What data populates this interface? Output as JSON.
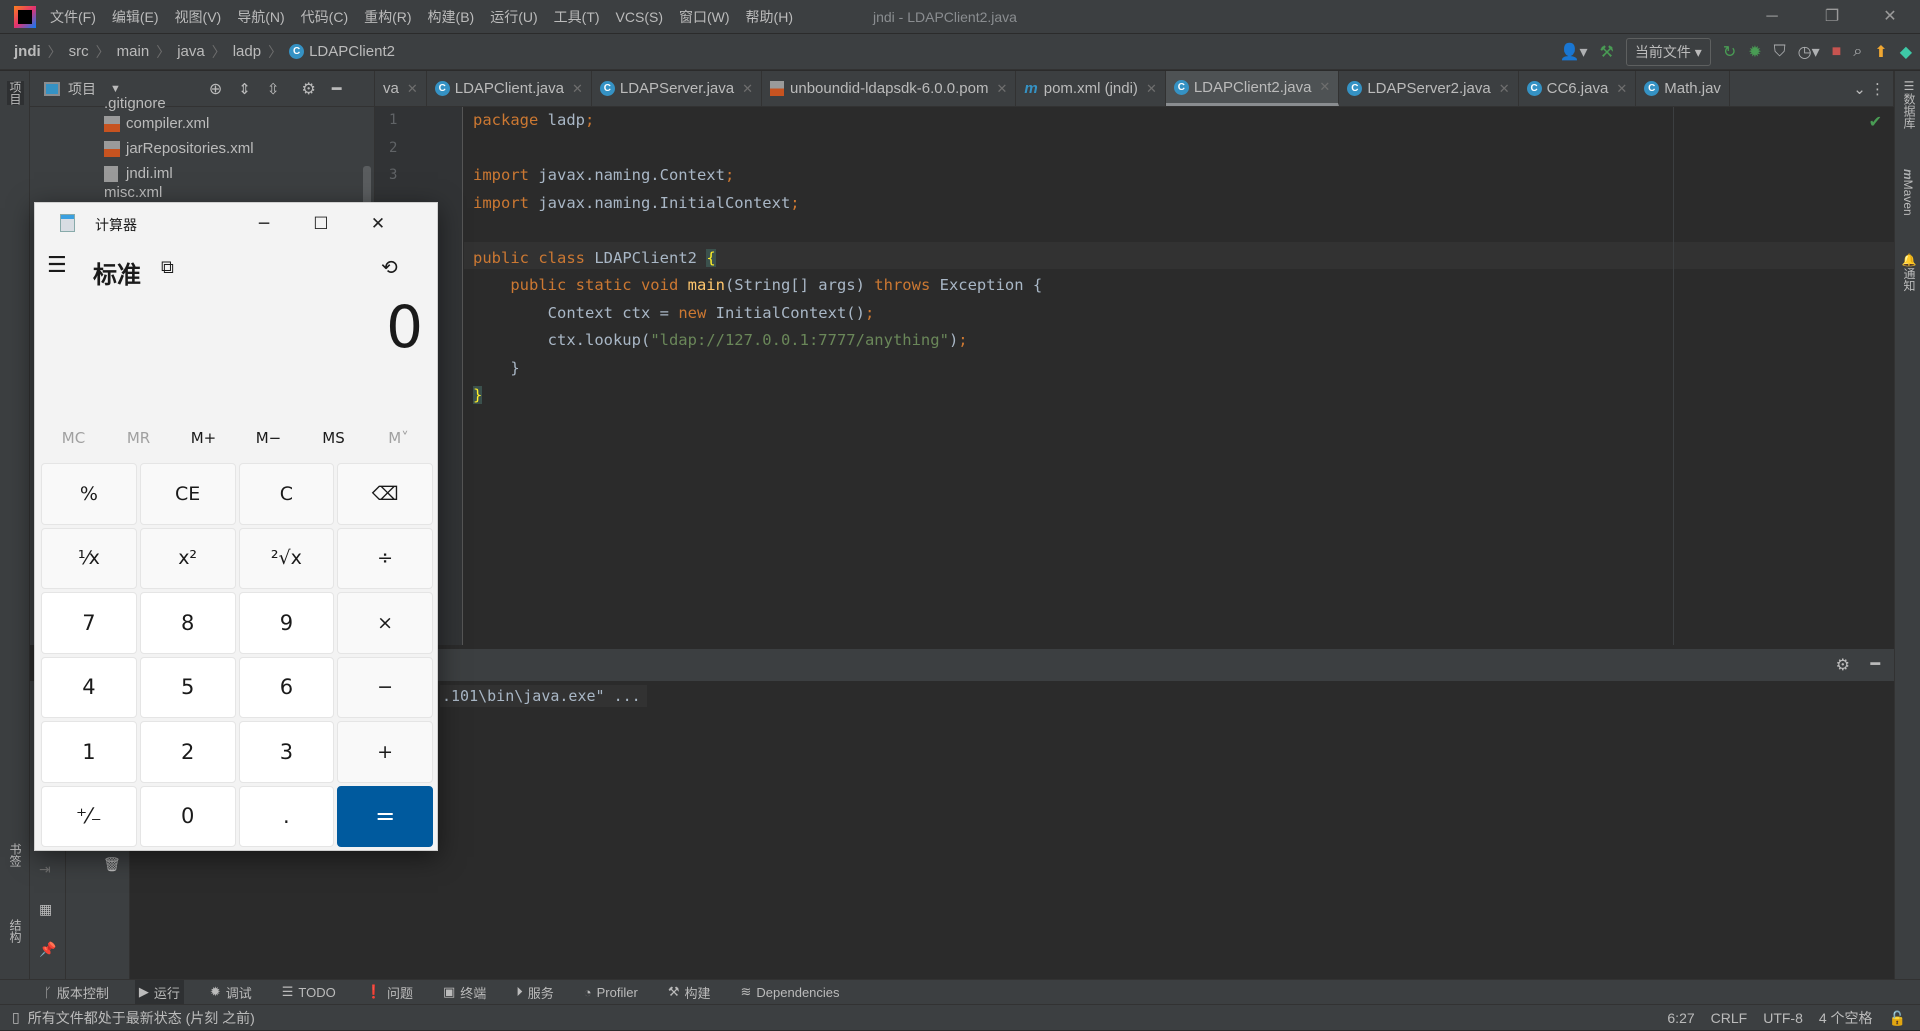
{
  "menubar": {
    "items": [
      "文件(F)",
      "编辑(E)",
      "视图(V)",
      "导航(N)",
      "代码(C)",
      "重构(R)",
      "构建(B)",
      "运行(U)",
      "工具(T)",
      "VCS(S)",
      "窗口(W)",
      "帮助(H)"
    ],
    "window_title": "jndi - LDAPClient2.java"
  },
  "breadcrumb": [
    "jndi",
    "src",
    "main",
    "java",
    "ladp",
    "LDAPClient2"
  ],
  "toolbar": {
    "scope": "当前文件"
  },
  "project_panel": {
    "title": "项目",
    "files": [
      ".gitignore",
      "compiler.xml",
      "jarRepositories.xml",
      "jndi.iml",
      "misc.xml"
    ]
  },
  "left_strip": {
    "project": "项目",
    "bookmarks": "书签",
    "structure": "结构"
  },
  "right_strip": {
    "database": "数据库",
    "maven": "Maven",
    "notifications": "通知"
  },
  "tabs": [
    {
      "label": "va",
      "icon": "java-class-icon"
    },
    {
      "label": "LDAPClient.java",
      "icon": "java-class-icon"
    },
    {
      "label": "LDAPServer.java",
      "icon": "java-class-icon"
    },
    {
      "label": "unboundid-ldapsdk-6.0.0.pom",
      "icon": "pom-file-icon"
    },
    {
      "label": "pom.xml (jndi)",
      "icon": "maven-icon"
    },
    {
      "label": "LDAPClient2.java",
      "icon": "java-class-icon",
      "active": true
    },
    {
      "label": "LDAPServer2.java",
      "icon": "java-class-icon"
    },
    {
      "label": "CC6.java",
      "icon": "java-class-icon"
    },
    {
      "label": "Math.jav",
      "icon": "java-class-icon"
    }
  ],
  "editor": {
    "line_numbers": [
      "1",
      "2",
      "3"
    ],
    "lines": [
      [
        {
          "t": "package ",
          "c": "k"
        },
        {
          "t": "ladp"
        },
        {
          "t": ";",
          "c": "p"
        }
      ],
      [],
      [
        {
          "t": "import ",
          "c": "k"
        },
        {
          "t": "javax.naming.Context"
        },
        {
          "t": ";",
          "c": "p"
        }
      ],
      [
        {
          "t": "import ",
          "c": "k"
        },
        {
          "t": "javax.naming.InitialContext"
        },
        {
          "t": ";",
          "c": "p"
        }
      ],
      [],
      [
        {
          "t": "public class ",
          "c": "k"
        },
        {
          "t": "LDAPClient2 "
        },
        {
          "t": "{",
          "c": "b"
        }
      ],
      [
        {
          "t": "    public static void ",
          "c": "k"
        },
        {
          "t": "main",
          "c": "f"
        },
        {
          "t": "(String[] args) "
        },
        {
          "t": "throws ",
          "c": "k"
        },
        {
          "t": "Exception {"
        }
      ],
      [
        {
          "t": "        Context ctx = "
        },
        {
          "t": "new ",
          "c": "k"
        },
        {
          "t": "InitialContext()"
        },
        {
          "t": ";",
          "c": "p"
        }
      ],
      [
        {
          "t": "        ctx.lookup("
        },
        {
          "t": "\"ldap://127.0.0.1:7777/anything\"",
          "c": "s"
        },
        {
          "t": ")"
        },
        {
          "t": ";",
          "c": "p"
        }
      ],
      [
        {
          "t": "    }"
        }
      ],
      [
        {
          "t": "}",
          "c": "b"
        }
      ]
    ]
  },
  "console": {
    "text": ".101\\bin\\java.exe\" ..."
  },
  "bottom_tools": [
    "版本控制",
    "运行",
    "调试",
    "TODO",
    "问题",
    "终端",
    "服务",
    "Profiler",
    "构建",
    "Dependencies"
  ],
  "status": {
    "message": "所有文件都处于最新状态 (片刻 之前)",
    "position": "6:27",
    "line_ending": "CRLF",
    "encoding": "UTF-8",
    "indent": "4 个空格"
  },
  "calculator": {
    "title": "计算器",
    "mode": "标准",
    "display": "0",
    "memory": [
      {
        "label": "MC",
        "enabled": false
      },
      {
        "label": "MR",
        "enabled": false
      },
      {
        "label": "M+",
        "enabled": true
      },
      {
        "label": "M−",
        "enabled": true
      },
      {
        "label": "MS",
        "enabled": true
      },
      {
        "label": "M˅",
        "enabled": false
      }
    ],
    "keys": [
      "%",
      "CE",
      "C",
      "⌫",
      "¹⁄x",
      "x²",
      "²√x",
      "÷",
      "7",
      "8",
      "9",
      "×",
      "4",
      "5",
      "6",
      "−",
      "1",
      "2",
      "3",
      "+",
      "⁺⁄₋",
      "0",
      ".",
      "="
    ],
    "accent": "#005a9e"
  },
  "colors": {
    "keyword": "#cc7832",
    "string": "#6a8759",
    "method": "#ffc66d",
    "text": "#a9b7c6",
    "panel": "#3c3f41",
    "editor": "#2b2b2b"
  }
}
